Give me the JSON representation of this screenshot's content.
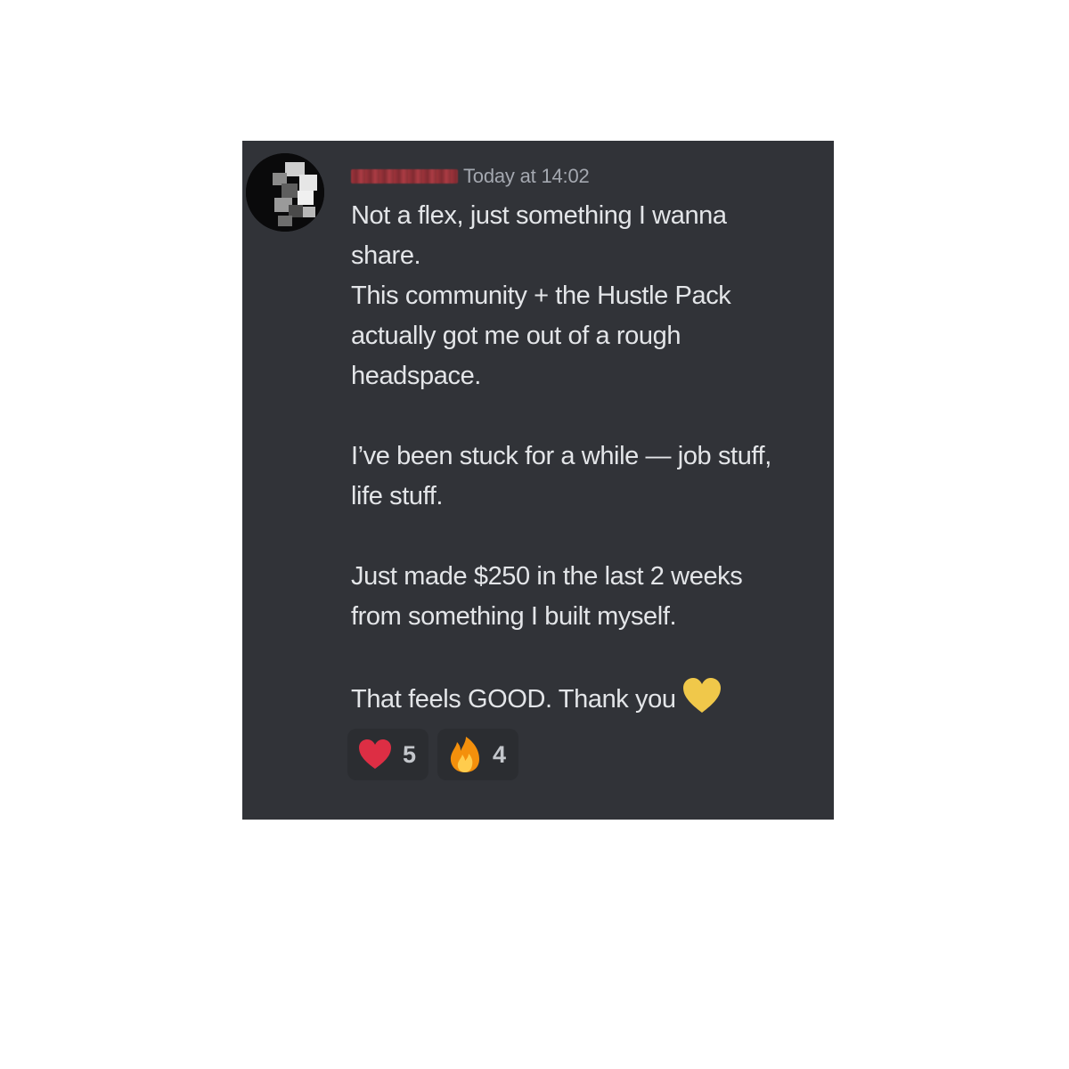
{
  "message": {
    "author": {
      "avatar": "pixelated-avatar",
      "username_color": "#b3343c"
    },
    "timestamp": "Today at 14:02",
    "lines": {
      "p1_l1": "Not a flex, just something I wanna",
      "p1_l2": "share.",
      "p1_l3": "This community + the Hustle Pack",
      "p1_l4": "actually got me out of a rough",
      "p1_l5": "headspace.",
      "p2_l1": "I’ve been stuck for a while — job stuff,",
      "p2_l2": "life stuff.",
      "p3_l1": "Just made $250 in the last 2 weeks",
      "p3_l2": "from something I built myself.",
      "p4_l1": "That feels GOOD. Thank you"
    },
    "inline_emoji": "yellow-heart-icon",
    "reactions": [
      {
        "emoji": "red-heart-icon",
        "count": "5"
      },
      {
        "emoji": "fire-icon",
        "count": "4"
      }
    ]
  },
  "colors": {
    "background": "#313338",
    "text": "#e3e5e8",
    "timestamp": "#a4a8b0",
    "reaction_bg": "#2b2d31",
    "yellow_heart": "#f0c84a",
    "red_heart": "#dd2e44",
    "fire": "#f4900c"
  }
}
